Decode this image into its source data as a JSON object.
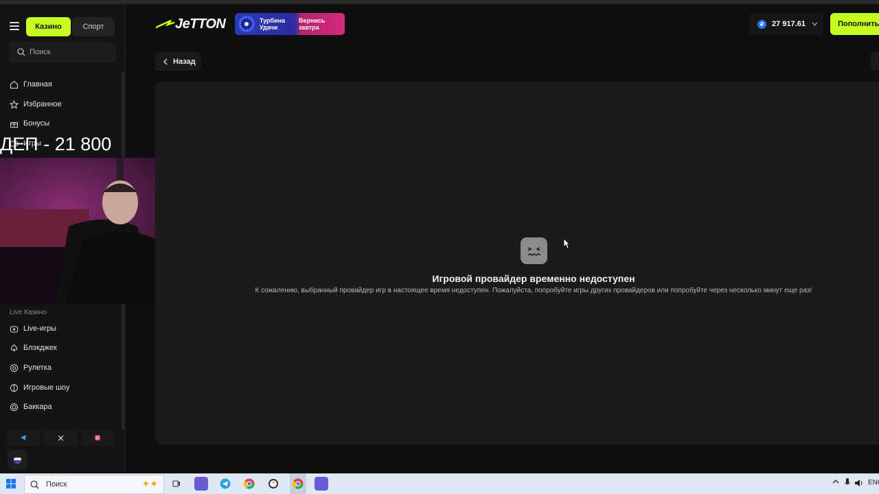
{
  "sidebar": {
    "tabs": [
      {
        "label": "Казино",
        "active": true
      },
      {
        "label": "Спорт",
        "active": false
      }
    ],
    "search_placeholder": "Поиск",
    "nav_items": [
      {
        "label": "Главная",
        "icon": "home-icon"
      },
      {
        "label": "Избранное",
        "icon": "star-icon"
      },
      {
        "label": "Бонусы",
        "icon": "gift-icon"
      },
      {
        "label": "Игры",
        "icon": "games-icon"
      }
    ],
    "live_section_label": "Live Казино",
    "live_items": [
      {
        "label": "Live-игры",
        "icon": "live-icon"
      },
      {
        "label": "Блэкджек",
        "icon": "spade-icon"
      },
      {
        "label": "Рулетка",
        "icon": "roulette-icon"
      },
      {
        "label": "Игровые шоу",
        "icon": "show-icon"
      },
      {
        "label": "Баккара",
        "icon": "baccarat-icon"
      }
    ],
    "socials": [
      "telegram-icon",
      "x-icon",
      "instagram-icon"
    ]
  },
  "overlay": {
    "deposit_text": "ДЕП -  21 800"
  },
  "header": {
    "logo_text": "JeTTON",
    "promo": {
      "line1": "Турбина Удачи",
      "line2": "Вернись завтра"
    },
    "balance": {
      "currency_symbol": "₽",
      "amount": "27 917.61"
    },
    "deposit_label": "Пополнить"
  },
  "main": {
    "back_label": "Назад",
    "error_title": "Игровой провайдер временно недоступен",
    "error_text": "К сожалению, выбранный провайдер игр в настоящее время недоступен. Пожалуйста, попробуйте игры других провайдеров или попробуйте через несколько минут еще раз!"
  },
  "taskbar": {
    "search_placeholder": "Поиск",
    "tray_lang": "ENG"
  },
  "colors": {
    "accent": "#c6ff1f",
    "background": "#0f0f10",
    "panel": "#1b1b1d"
  }
}
